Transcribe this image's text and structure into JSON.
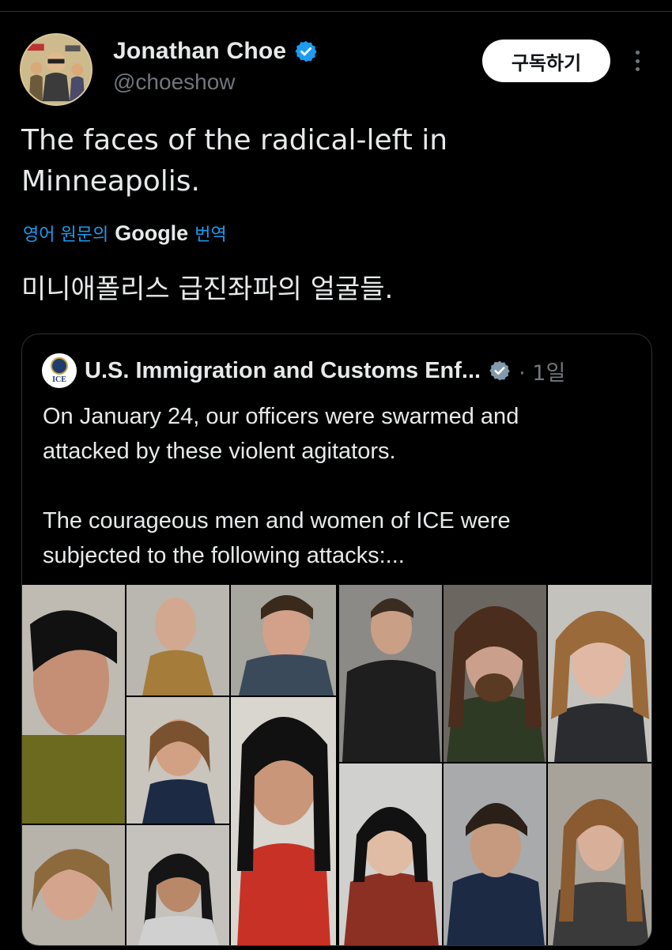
{
  "author": {
    "display_name": "Jonathan Choe",
    "handle": "@choeshow",
    "verified_icon": "verified-badge-icon",
    "subscribe_label": "구독하기",
    "more_icon": "more-vertical-icon"
  },
  "tweet": {
    "text_line1": "The faces of the radical-left in",
    "text_line2": "Minneapolis.",
    "translate_prefix": "영어 원문의",
    "translate_google": "Google",
    "translate_suffix": "번역",
    "translation": "미니애폴리스 급진좌파의 얼굴들."
  },
  "quote": {
    "name": "U.S. Immigration and Customs Enf...",
    "avatar_text": "ICE",
    "time": "· 1일",
    "body": "On January 24, our officers were swarmed and\nattacked by these violent agitators.\n\nThe courageous men and women of ICE were\nsubjected to the following attacks:..."
  },
  "colors": {
    "background": "#000000",
    "text": "#e7e9ea",
    "muted": "#71767b",
    "link": "#1d9bf0",
    "verified": "#1d9bf0",
    "border": "#2f3336"
  }
}
